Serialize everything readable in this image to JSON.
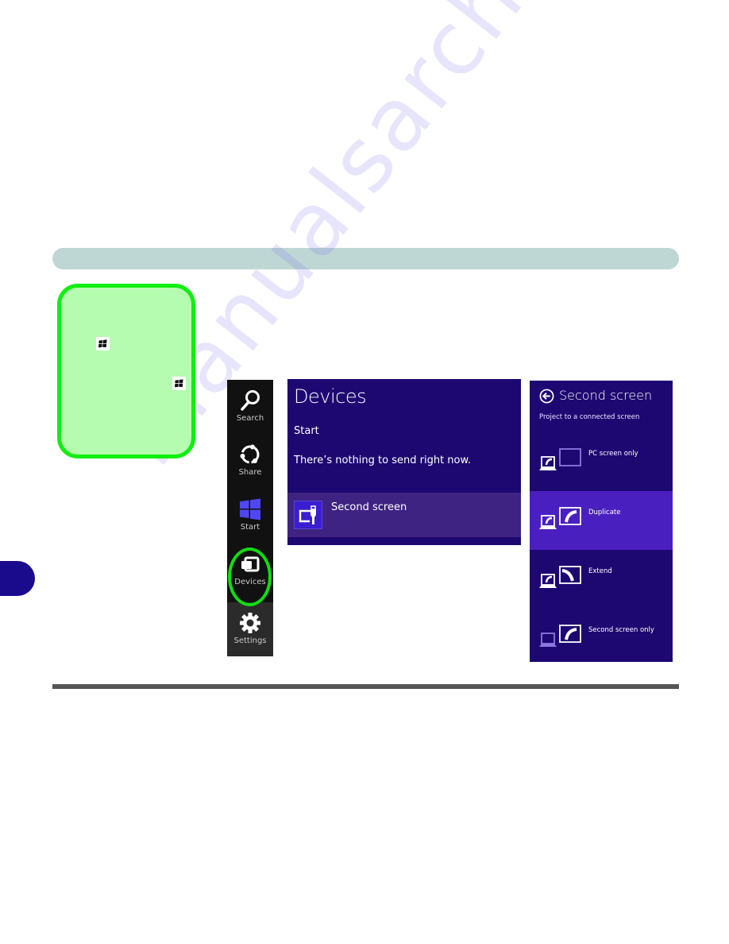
{
  "charm_bar": {
    "items": [
      {
        "label": "Search",
        "icon": "search-icon"
      },
      {
        "label": "Share",
        "icon": "share-icon"
      },
      {
        "label": "Start",
        "icon": "windows-start-icon"
      },
      {
        "label": "Devices",
        "icon": "devices-icon"
      },
      {
        "label": "Settings",
        "icon": "gear-icon"
      }
    ],
    "highlighted": "Devices"
  },
  "devices_panel": {
    "title": "Devices",
    "section": "Start",
    "message": "There’s nothing to send right now.",
    "item": {
      "label": "Second screen",
      "icon": "second-screen-icon"
    }
  },
  "second_screen_panel": {
    "title": "Second screen",
    "back_icon": "back-arrow-icon",
    "subtitle": "Project to a connected screen",
    "options": [
      {
        "label": "PC screen only",
        "selected": false
      },
      {
        "label": "Duplicate",
        "selected": true
      },
      {
        "label": "Extend",
        "selected": false
      },
      {
        "label": "Second screen only",
        "selected": false
      }
    ]
  },
  "callout": {
    "icons": [
      "windows-logo-icon",
      "windows-logo-icon"
    ]
  },
  "colors": {
    "panel_bg": "#1d0872",
    "selected_option": "#4a1fc0",
    "highlight_row": "#3e2382",
    "charm_bg": "#111111",
    "callout_border": "#11ee11",
    "callout_fill": "#b5fbb0",
    "header_band": "#bed6d4",
    "chapter_tab": "#1a0a8c"
  },
  "watermark": "manualsarchive.com"
}
